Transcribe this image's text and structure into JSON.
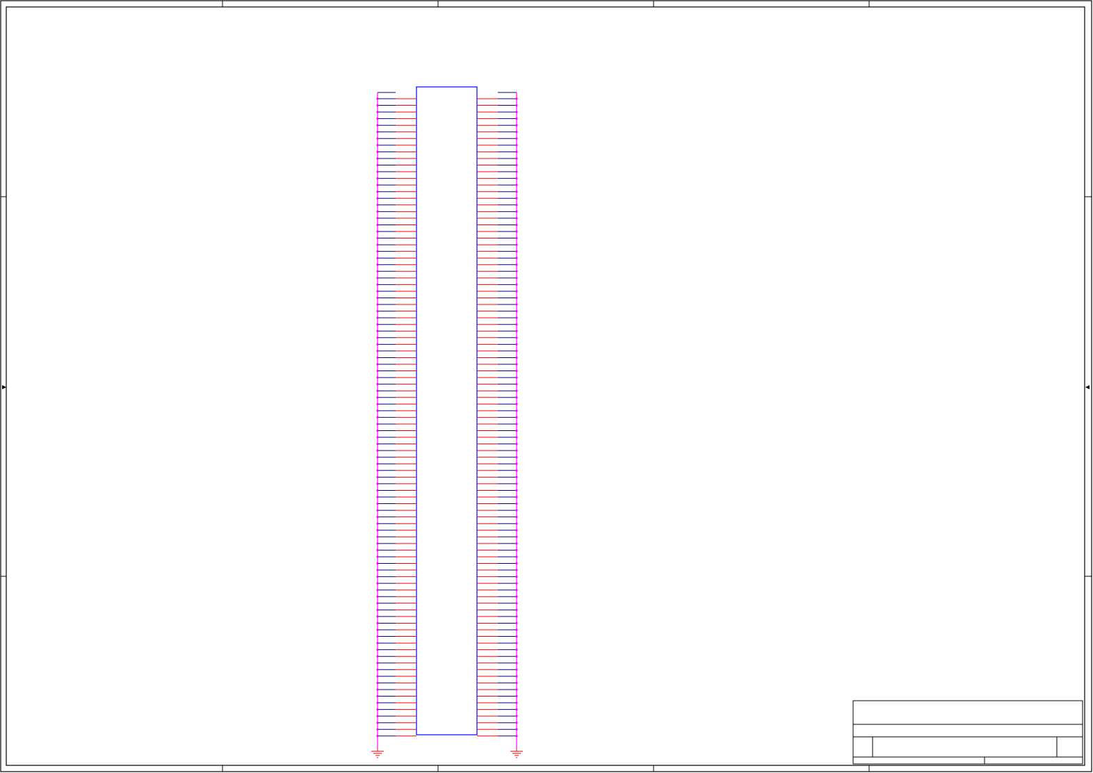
{
  "sheet": {
    "zone_columns": 5,
    "zone_rows": 4,
    "title_block": {
      "title": "",
      "size": "",
      "document_number": "",
      "revision": "",
      "date": "",
      "sheet": ""
    }
  },
  "connector": {
    "reference": "",
    "pins_per_side": 97,
    "left_pins_to_ground": true,
    "right_pins_to_ground": true
  },
  "colors": {
    "border": "#000000",
    "component_body": "#0000ff",
    "pin": "#ff0000",
    "wire": "#000080",
    "junction": "#ff00ff",
    "ground_symbol": "#ff0000"
  },
  "icons": {
    "ground": "ground-icon",
    "junction": "junction-dot-icon",
    "port": "arrow-icon"
  }
}
